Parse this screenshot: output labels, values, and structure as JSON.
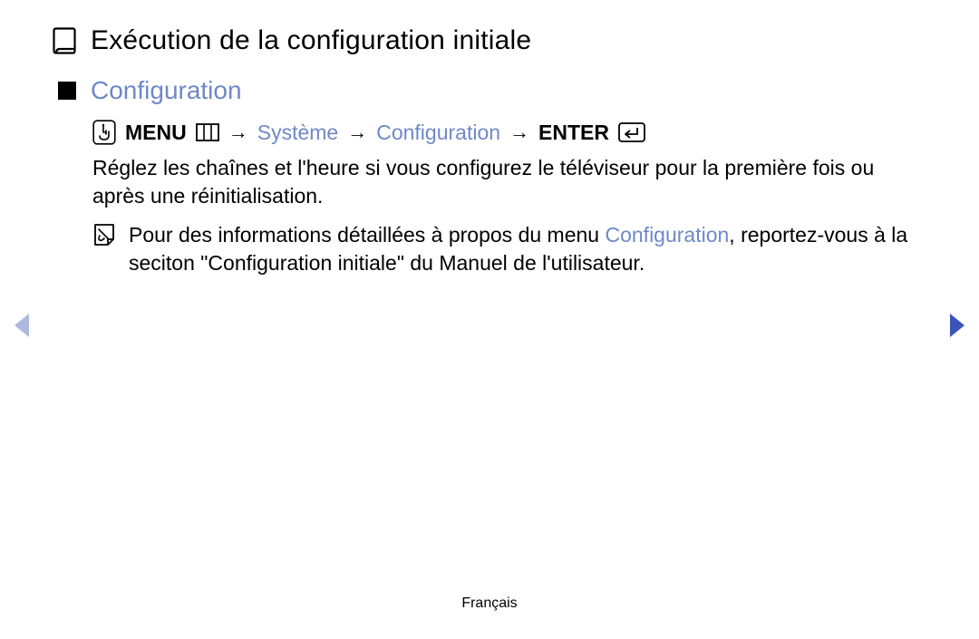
{
  "title": "Exécution de la configuration initiale",
  "section": "Configuration",
  "breadcrumb": {
    "menu_label": "MENU",
    "arrow": "→",
    "path1": "Système",
    "path2": "Configuration",
    "enter_label": "ENTER"
  },
  "body": "Réglez les chaînes et l'heure si vous configurez le téléviseur pour la première fois ou après une réinitialisation.",
  "note": {
    "pre": "Pour des informations détaillées à propos du menu ",
    "link": "Configuration",
    "post": ", reportez-vous à la seciton \"Configuration initiale\" du Manuel de l'utilisateur."
  },
  "footer": "Français"
}
